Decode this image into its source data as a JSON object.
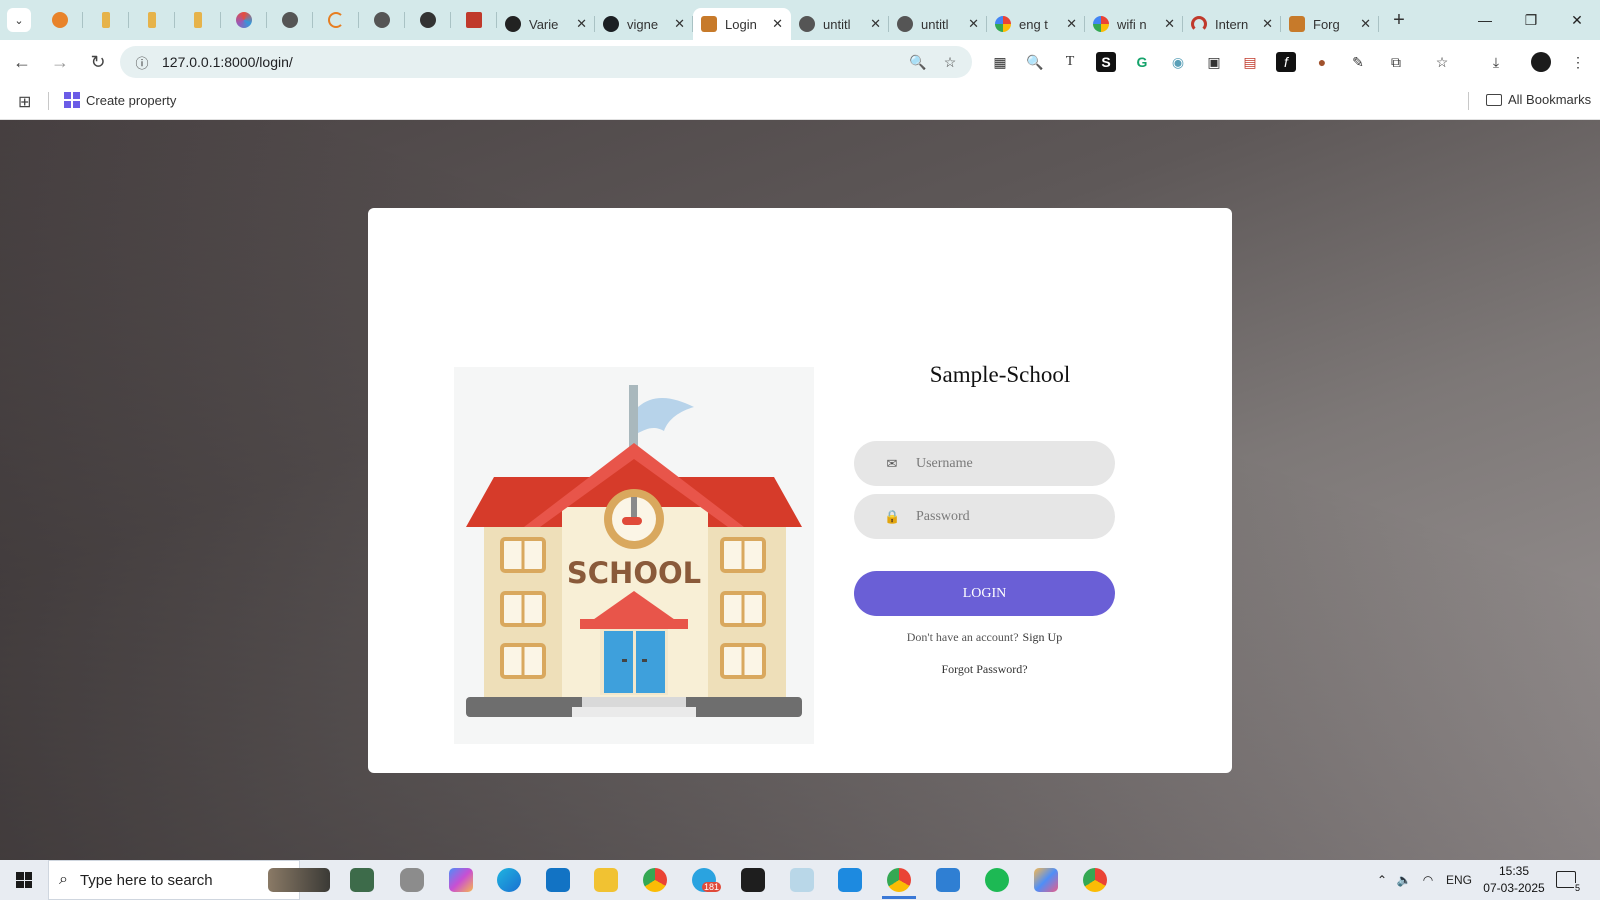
{
  "browser": {
    "tabs": [
      {
        "title": "Varie",
        "favicon": "target-icon",
        "color": "#222222"
      },
      {
        "title": "vigne",
        "favicon": "github-icon",
        "color": "#1b1f23"
      },
      {
        "title": "Login",
        "favicon": "school-icon",
        "color": "#c77a2a",
        "active": true
      },
      {
        "title": "untitl",
        "favicon": "globe-icon",
        "color": "#555555"
      },
      {
        "title": "untitl",
        "favicon": "globe-icon",
        "color": "#555555"
      },
      {
        "title": "eng t",
        "favicon": "google-icon",
        "color": "#4285f4"
      },
      {
        "title": "wifi n",
        "favicon": "google-icon",
        "color": "#4285f4"
      },
      {
        "title": "Intern",
        "favicon": "speedometer-icon",
        "color": "#c0392b"
      },
      {
        "title": "Forg",
        "favicon": "school-icon",
        "color": "#c77a2a"
      }
    ],
    "address": "127.0.0.1:8000/login/",
    "bookmark": "Create property",
    "all_bookmarks": "All Bookmarks"
  },
  "login": {
    "title": "Sample-School",
    "username_placeholder": "Username",
    "password_placeholder": "Password",
    "login_button": "LOGIN",
    "signup_prompt": "Don't have an account?",
    "signup_link": "Sign Up",
    "forgot_link": "Forgot Password?",
    "illustration_text": "SCHOOL"
  },
  "taskbar": {
    "search_placeholder": "Type here to search",
    "language": "ENG",
    "time": "15:35",
    "date": "07-03-2025",
    "notifications": "5",
    "telegram_badge": "181"
  },
  "colors": {
    "accent": "#6a5fd6",
    "tabstrip": "#d4e9ea"
  }
}
